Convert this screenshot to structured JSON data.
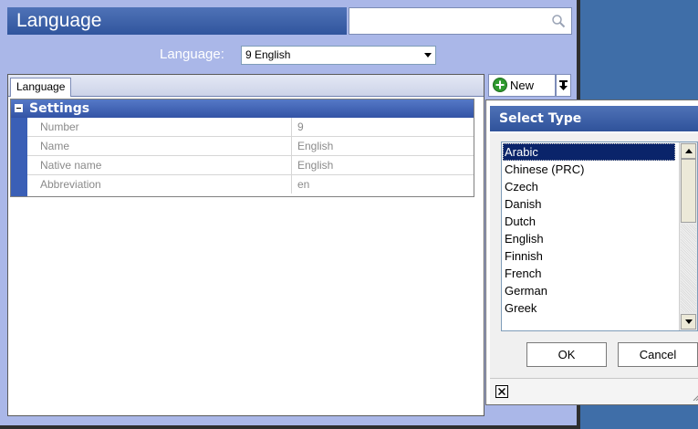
{
  "window": {
    "title": "Language"
  },
  "search": {
    "placeholder": ""
  },
  "language_selector": {
    "label": "Language:",
    "value": "9 English"
  },
  "tabs": [
    {
      "label": "Language"
    }
  ],
  "settings": {
    "title": "Settings",
    "rows": [
      {
        "key": "Number",
        "value": "9"
      },
      {
        "key": "Name",
        "value": "English"
      },
      {
        "key": "Native name",
        "value": "English"
      },
      {
        "key": "Abbreviation",
        "value": "en"
      }
    ]
  },
  "toolbar": {
    "new_label": "New"
  },
  "select_type": {
    "title": "Select Type",
    "items": [
      "Arabic",
      "Chinese (PRC)",
      "Czech",
      "Danish",
      "Dutch",
      "English",
      "Finnish",
      "French",
      "German",
      "Greek"
    ],
    "selected": "Arabic",
    "ok_label": "OK",
    "cancel_label": "Cancel"
  },
  "colors": {
    "title_blue": "#3a5fa8",
    "window_bg": "#aab7e8",
    "desktop_blue": "#3f6ea8",
    "selection": "#0a246a"
  }
}
